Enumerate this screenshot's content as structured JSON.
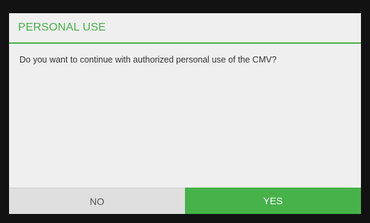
{
  "dialog": {
    "title": "PERSONAL USE",
    "message": "Do you want to continue with authorized personal use of the CMV?",
    "buttons": {
      "no_label": "NO",
      "yes_label": "YES"
    }
  },
  "colors": {
    "accent": "#47b14a",
    "background": "#121212",
    "dialog_background": "#efefef",
    "no_button_background": "#dfdfdf"
  }
}
